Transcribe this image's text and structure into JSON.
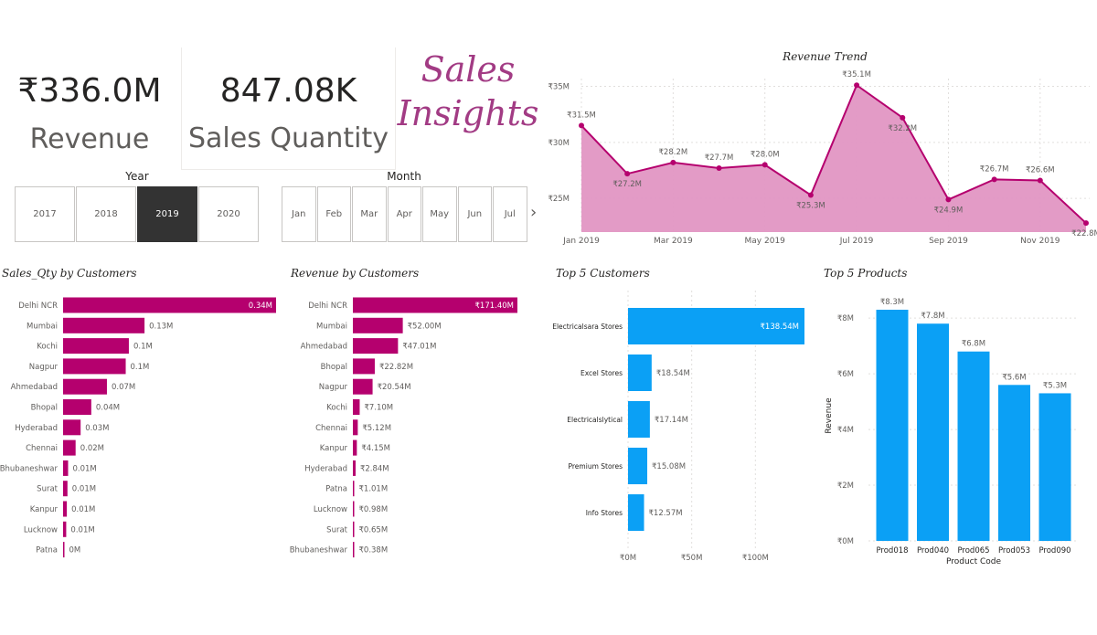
{
  "kpis": {
    "revenue": {
      "value": "₹336.0M",
      "label": "Revenue"
    },
    "quantity": {
      "value": "847.08K",
      "label": "Sales Quantity"
    }
  },
  "brand": {
    "line1": "Sales",
    "line2": "Insights"
  },
  "year_slicer": {
    "title": "Year",
    "options": [
      "2017",
      "2018",
      "2019",
      "2020"
    ],
    "selected": "2019"
  },
  "month_slicer": {
    "title": "Month",
    "options": [
      "Jan",
      "Feb",
      "Mar",
      "Apr",
      "May",
      "Jun",
      "Jul"
    ],
    "next_glyph": "›"
  },
  "colors": {
    "magenta": "#b5006e",
    "area_fill": "#e196c3",
    "blue": "#0ba0f5",
    "selected": "#333333",
    "brand": "#a23b84"
  },
  "chart_data": [
    {
      "id": "revenue_trend",
      "type": "area",
      "title": "Revenue Trend",
      "x": [
        "Jan 2019",
        "Feb 2019",
        "Mar 2019",
        "Apr 2019",
        "May 2019",
        "Jun 2019",
        "Jul 2019",
        "Aug 2019",
        "Sep 2019",
        "Oct 2019",
        "Nov 2019",
        "Dec 2019"
      ],
      "values": [
        31.5,
        27.2,
        28.2,
        27.7,
        28.0,
        25.3,
        35.1,
        32.2,
        24.9,
        26.7,
        26.6,
        22.8
      ],
      "data_labels": [
        "₹31.5M",
        "₹27.2M",
        "₹28.2M",
        "₹27.7M",
        "₹28.0M",
        "₹25.3M",
        "₹35.1M",
        "₹32.2M",
        "₹24.9M",
        "₹26.7M",
        "₹26.6M",
        "₹22.8M"
      ],
      "x_ticks": [
        {
          "index": 0,
          "label": "Jan 2019"
        },
        {
          "index": 2,
          "label": "Mar 2019"
        },
        {
          "index": 4,
          "label": "May 2019"
        },
        {
          "index": 6,
          "label": "Jul 2019"
        },
        {
          "index": 8,
          "label": "Sep 2019"
        },
        {
          "index": 10,
          "label": "Nov 2019"
        }
      ],
      "y_ticks": [
        {
          "value": 25,
          "label": "₹25M"
        },
        {
          "value": 30,
          "label": "₹30M"
        },
        {
          "value": 35,
          "label": "₹35M"
        }
      ],
      "ylim": [
        22.0,
        35.2
      ],
      "grid": true
    },
    {
      "id": "qty_by_customers",
      "type": "bar",
      "orientation": "horizontal",
      "title": "Sales_Qty by Customers",
      "categories": [
        "Delhi NCR",
        "Mumbai",
        "Kochi",
        "Nagpur",
        "Ahmedabad",
        "Bhopal",
        "Hyderabad",
        "Chennai",
        "Bhubaneshwar",
        "Surat",
        "Kanpur",
        "Lucknow",
        "Patna"
      ],
      "values": [
        0.34,
        0.13,
        0.105,
        0.1,
        0.07,
        0.045,
        0.028,
        0.02,
        0.008,
        0.007,
        0.006,
        0.005,
        0.001
      ],
      "data_labels": [
        "0.34M",
        "0.13M",
        "0.1M",
        "0.1M",
        "0.07M",
        "0.04M",
        "0.03M",
        "0.02M",
        "0.01M",
        "0.01M",
        "0.01M",
        "0.01M",
        "0M"
      ],
      "xlim": [
        0,
        0.34
      ]
    },
    {
      "id": "revenue_by_customers",
      "type": "bar",
      "orientation": "horizontal",
      "title": "Revenue by Customers",
      "categories": [
        "Delhi NCR",
        "Mumbai",
        "Ahmedabad",
        "Bhopal",
        "Nagpur",
        "Kochi",
        "Chennai",
        "Kanpur",
        "Hyderabad",
        "Patna",
        "Lucknow",
        "Surat",
        "Bhubaneshwar"
      ],
      "values": [
        171.4,
        52.0,
        47.01,
        22.82,
        20.54,
        7.1,
        5.12,
        4.15,
        2.84,
        1.01,
        0.98,
        0.65,
        0.38
      ],
      "data_labels": [
        "₹171.40M",
        "₹52.00M",
        "₹47.01M",
        "₹22.82M",
        "₹20.54M",
        "₹7.10M",
        "₹5.12M",
        "₹4.15M",
        "₹2.84M",
        "₹1.01M",
        "₹0.98M",
        "₹0.65M",
        "₹0.38M"
      ],
      "xlim": [
        0,
        171.4
      ]
    },
    {
      "id": "top5_customers",
      "type": "bar",
      "orientation": "horizontal",
      "title": "Top 5 Customers",
      "categories": [
        "Electricalsara Stores",
        "Excel Stores",
        "Electricalslytical",
        "Premium Stores",
        "Info Stores"
      ],
      "values": [
        138.54,
        18.54,
        17.14,
        15.08,
        12.57
      ],
      "data_labels": [
        "₹138.54M",
        "₹18.54M",
        "₹17.14M",
        "₹15.08M",
        "₹12.57M"
      ],
      "x_ticks": [
        {
          "value": 0,
          "label": "₹0M"
        },
        {
          "value": 50,
          "label": "₹50M"
        },
        {
          "value": 100,
          "label": "₹100M"
        }
      ],
      "xlim": [
        0,
        138.54
      ],
      "grid": true
    },
    {
      "id": "top5_products",
      "type": "bar",
      "title": "Top 5 Products",
      "categories": [
        "Prod018",
        "Prod040",
        "Prod065",
        "Prod053",
        "Prod090"
      ],
      "values": [
        8.3,
        7.8,
        6.8,
        5.6,
        5.3
      ],
      "data_labels": [
        "₹8.3M",
        "₹7.8M",
        "₹6.8M",
        "₹5.6M",
        "₹5.3M"
      ],
      "y_ticks": [
        {
          "value": 0,
          "label": "₹0M"
        },
        {
          "value": 2,
          "label": "₹2M"
        },
        {
          "value": 4,
          "label": "₹4M"
        },
        {
          "value": 6,
          "label": "₹6M"
        },
        {
          "value": 8,
          "label": "₹8M"
        }
      ],
      "xlabel": "Product Code",
      "ylabel": "Revenue",
      "ylim": [
        0,
        8.3
      ],
      "grid": true
    }
  ]
}
